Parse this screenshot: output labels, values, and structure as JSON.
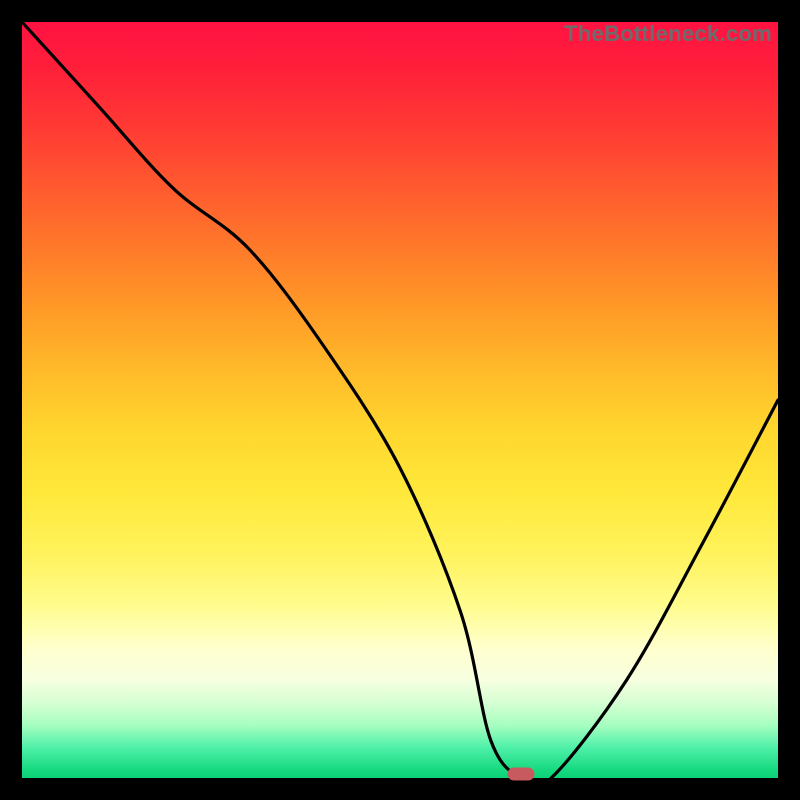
{
  "watermark": "TheBottleneck.com",
  "chart_data": {
    "type": "line",
    "title": "",
    "xlabel": "",
    "ylabel": "",
    "x_range": [
      0,
      100
    ],
    "y_range": [
      0,
      100
    ],
    "series": [
      {
        "name": "bottleneck-curve",
        "x": [
          0,
          10,
          20,
          30,
          40,
          50,
          58,
          62,
          66,
          70,
          80,
          90,
          100
        ],
        "y": [
          100,
          89,
          78,
          70,
          57,
          41,
          22,
          5,
          0,
          0,
          13,
          31,
          50
        ]
      }
    ],
    "marker": {
      "x": 66,
      "y": 0,
      "color": "#c65a5f"
    },
    "background_gradient": {
      "top_color": "#ff1242",
      "bottom_color": "#0cd276"
    }
  }
}
